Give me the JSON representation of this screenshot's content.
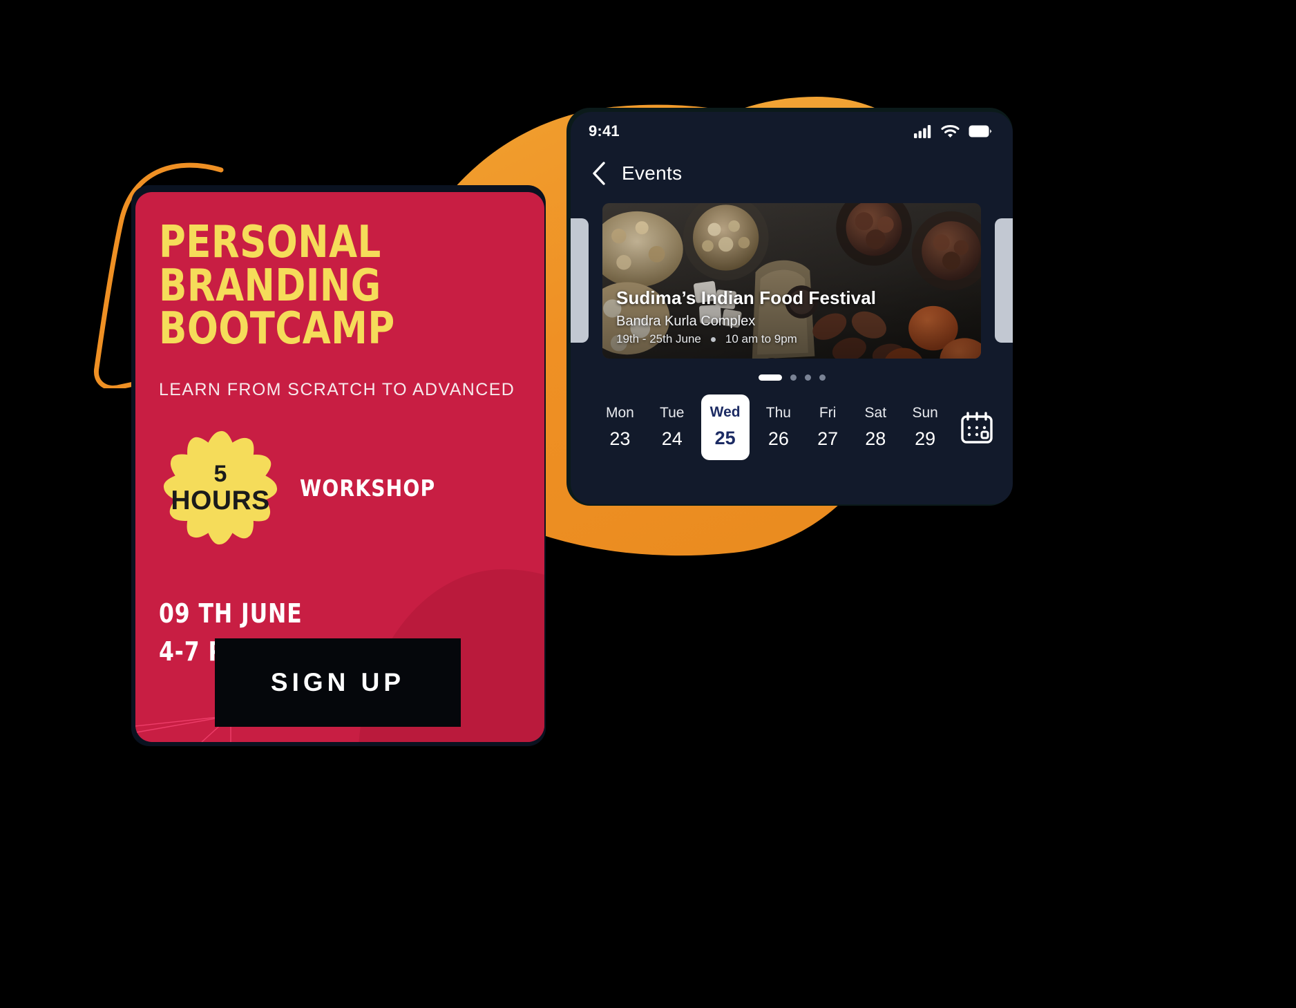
{
  "poster": {
    "title": "PERSONAL BRANDING\nBOOTCAMP",
    "subtitle": "LEARN FROM SCRATCH TO ADVANCED",
    "badge": {
      "number": "5",
      "unit": "HOURS"
    },
    "workshop_label": "WORKSHOP",
    "date": "09 TH JUNE",
    "time": "4-7 PM",
    "cta_label": "SIGN UP",
    "colors": {
      "background": "#C81E43",
      "title": "#F5DC5A",
      "badge": "#F5DC5A",
      "cta_background": "#05070B",
      "cta_text": "#FFFFFF",
      "accent_orange": "#EF9024"
    }
  },
  "phone": {
    "status_bar": {
      "time": "9:41",
      "icons": [
        "cellular-signal-icon",
        "wifi-icon",
        "battery-icon"
      ]
    },
    "nav": {
      "back_icon": "chevron-left-icon",
      "title": "Events"
    },
    "event_card": {
      "title": "Sudima’s Indian Food Festival",
      "venue": "Bandra Kurla Complex",
      "dates": "19th - 25th June",
      "hours": "10 am to 9pm"
    },
    "carousel": {
      "total_dots": 4,
      "active_index": 0
    },
    "day_strip": {
      "days": [
        {
          "name": "Mon",
          "num": "23",
          "selected": false
        },
        {
          "name": "Tue",
          "num": "24",
          "selected": false
        },
        {
          "name": "Wed",
          "num": "25",
          "selected": true
        },
        {
          "name": "Thu",
          "num": "26",
          "selected": false
        },
        {
          "name": "Fri",
          "num": "27",
          "selected": false
        },
        {
          "name": "Sat",
          "num": "28",
          "selected": false
        },
        {
          "name": "Sun",
          "num": "29",
          "selected": false
        }
      ],
      "calendar_icon": "calendar-icon"
    },
    "colors": {
      "background": "#121A2B",
      "selected_day_text": "#1C2B63",
      "selected_day_background": "#FFFFFF"
    }
  }
}
